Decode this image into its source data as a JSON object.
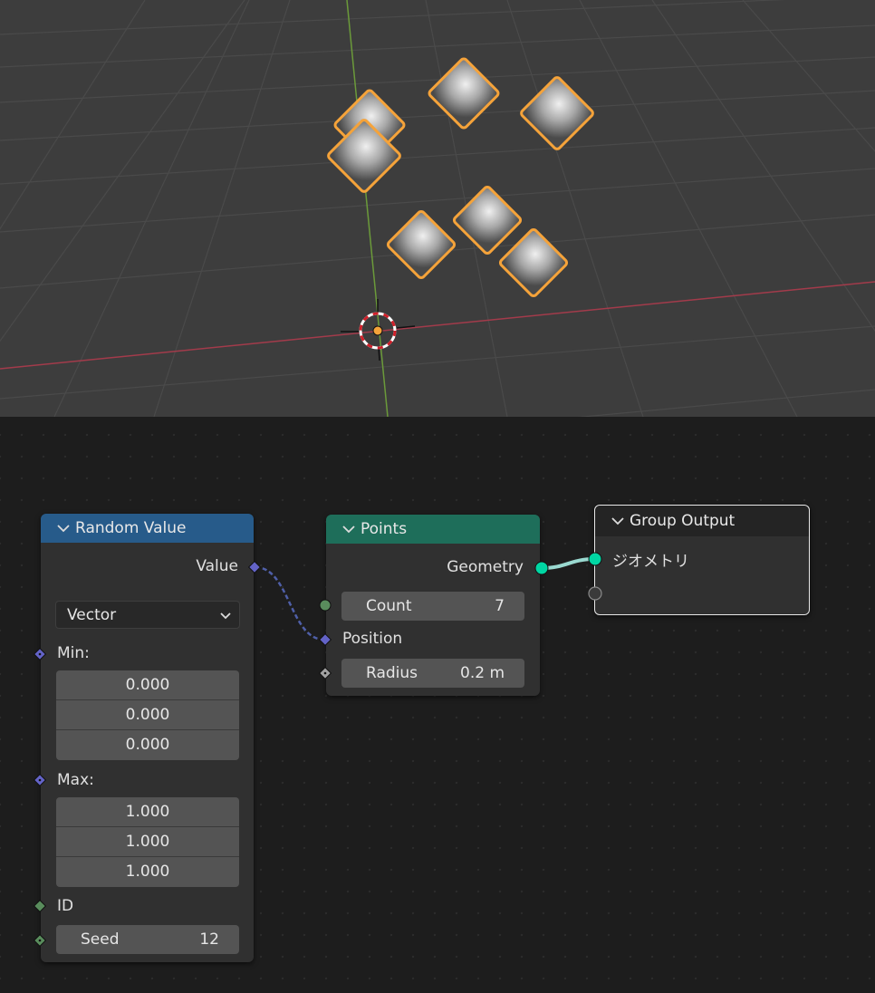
{
  "random_value_node": {
    "title": "Random Value",
    "output_label": "Value",
    "data_type": "Vector",
    "min_label": "Min:",
    "min": [
      "0.000",
      "0.000",
      "0.000"
    ],
    "max_label": "Max:",
    "max": [
      "1.000",
      "1.000",
      "1.000"
    ],
    "id_label": "ID",
    "seed_label": "Seed",
    "seed_value": "12",
    "header_color": "#275b8a"
  },
  "points_node": {
    "title": "Points",
    "output_label": "Geometry",
    "count_label": "Count",
    "count_value": "7",
    "position_label": "Position",
    "radius_label": "Radius",
    "radius_value": "0.2 m",
    "header_color": "#1e6e5a"
  },
  "group_output_node": {
    "title": "Group Output",
    "input_label": "ジオメトリ"
  },
  "colors": {
    "selection_outline": "#f5a33a",
    "vector_socket": "#6363c7",
    "geometry_socket": "#00d6a3",
    "int_socket": "#598c5c",
    "float_socket": "#a1a1a1",
    "x_axis": "#a33b4b",
    "y_axis": "#6b9a3a"
  },
  "viewport": {
    "point_count": 7
  }
}
